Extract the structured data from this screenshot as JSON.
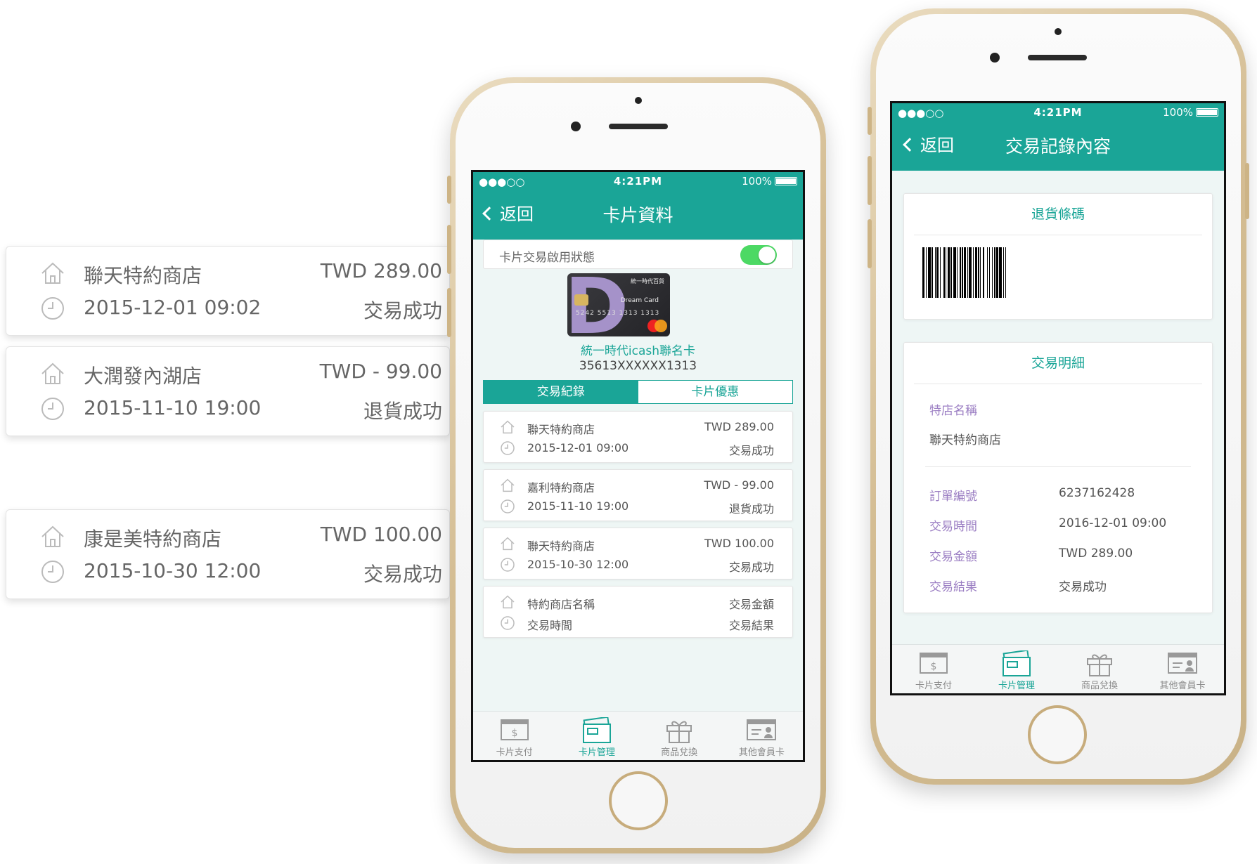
{
  "colors": {
    "teal": "#1aa597",
    "purple": "#9b7ec3",
    "gold": "#d4bd93"
  },
  "float_cards": [
    {
      "name": "聯天特約商店",
      "date": "2015-12-01  09:02",
      "amount": "TWD  289.00",
      "status": "交易成功"
    },
    {
      "name": "大潤發內湖店",
      "date": "2015-11-10  19:00",
      "amount": "TWD  - 99.00",
      "status": "退貨成功"
    },
    {
      "name": "康是美特約商店",
      "date": "2015-10-30  12:00",
      "amount": "TWD  100.00",
      "status": "交易成功"
    }
  ],
  "status_bar": {
    "signal": "●●●○○",
    "time": "4:21PM",
    "battery": "100%"
  },
  "phone2": {
    "back": "返回",
    "title": "卡片資料",
    "toggle_label": "卡片交易啟用狀態",
    "toggle_on": true,
    "card": {
      "brand": "統一時代百貨",
      "product": "Dream Card",
      "number_on_card": "5242  5513  1313  1313",
      "name": "統一時代icash聯名卡",
      "number": "35613XXXXXX1313"
    },
    "segments": {
      "active": "交易紀錄",
      "inactive": "卡片優惠"
    },
    "transactions": [
      {
        "name": "聯天特約商店",
        "date": "2015-12-01  09:00",
        "amount": "TWD  289.00",
        "status": "交易成功"
      },
      {
        "name": "嘉利特約商店",
        "date": "2015-11-10  19:00",
        "amount": "TWD  - 99.00",
        "status": "退貨成功"
      },
      {
        "name": "聯天特約商店",
        "date": "2015-10-30  12:00",
        "amount": "TWD  100.00",
        "status": "交易成功"
      },
      {
        "name": "特約商店名稱",
        "date": "交易時間",
        "amount": "交易金額",
        "status": "交易結果"
      }
    ]
  },
  "phone3": {
    "back": "返回",
    "title": "交易記錄內容",
    "barcode_title": "退貨條碼",
    "detail_title": "交易明細",
    "merchant_label": "特店名稱",
    "merchant_value": "聯天特約商店",
    "rows": [
      {
        "label": "訂單編號",
        "value": "6237162428"
      },
      {
        "label": "交易時間",
        "value": "2016-12-01 09:00"
      },
      {
        "label": "交易金額",
        "value": "TWD 289.00"
      },
      {
        "label": "交易結果",
        "value": "交易成功"
      }
    ]
  },
  "tabbar": {
    "tabs": [
      "卡片支付",
      "卡片管理",
      "商品兌換",
      "其他會員卡"
    ],
    "active": "卡片管理"
  },
  "icons": {
    "store": "house-icon",
    "time": "clock-icon",
    "back": "chevron-left-icon"
  }
}
